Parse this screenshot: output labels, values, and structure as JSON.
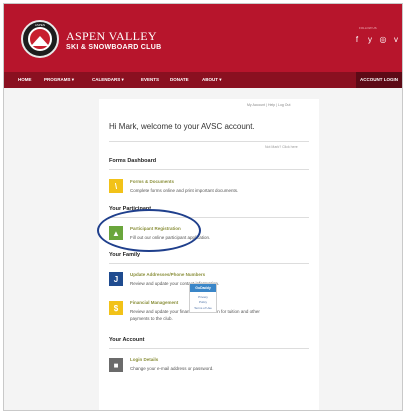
{
  "header": {
    "logo_top_text": "ASPEN",
    "brand_line1": "ASPEN VALLEY",
    "brand_line2": "SKI & SNOWBOARD CLUB",
    "follow_label": "FOLLOW US",
    "social_icons": [
      {
        "name": "facebook-icon",
        "glyph": "f"
      },
      {
        "name": "twitter-icon",
        "glyph": "y"
      },
      {
        "name": "instagram-icon",
        "glyph": "◎"
      },
      {
        "name": "vimeo-icon",
        "glyph": "v"
      }
    ]
  },
  "nav": {
    "items": [
      "HOME",
      "PROGRAMS ▾",
      "CALENDARS ▾",
      "EVENTS",
      "DONATE",
      "ABOUT ▾"
    ],
    "login": "ACCOUNT LOGIN"
  },
  "account": {
    "top_links": "My Account | Help | Log Out",
    "welcome": "Hi Mark, welcome to your AVSC account.",
    "not_me": "Not Mark? Click here"
  },
  "sections": {
    "forms": "Forms Dashboard",
    "participant": "Your Participant",
    "family": "Your Family",
    "account": "Your Account"
  },
  "items": {
    "forms_docs": {
      "title": "Forms & Documents",
      "desc": "Complete forms online and print important documents.",
      "glyph": "\\",
      "color": "#f2c218"
    },
    "participant_reg": {
      "title": "Participant Registration",
      "desc": "Fill out our online participant application.",
      "glyph": "▲",
      "color": "#6aa63c"
    },
    "addresses": {
      "title": "Update Addresses/Phone Numbers",
      "desc": "Review and update your contact information.",
      "glyph": "J",
      "color": "#1f4b8f"
    },
    "financial": {
      "title": "Financial Management",
      "desc_line1": "Review and update your financial information for tuition and other",
      "desc_line2": "payments to the club.",
      "glyph": "$",
      "color": "#f2c218"
    },
    "login": {
      "title": "Login Details",
      "desc": "Change your e-mail address or password.",
      "glyph": "■",
      "color": "#6b6b6b"
    }
  },
  "badge": {
    "title": "GoDaddy",
    "line1": "Privacy",
    "line2": "Policy",
    "line3": "Terms of Use"
  }
}
